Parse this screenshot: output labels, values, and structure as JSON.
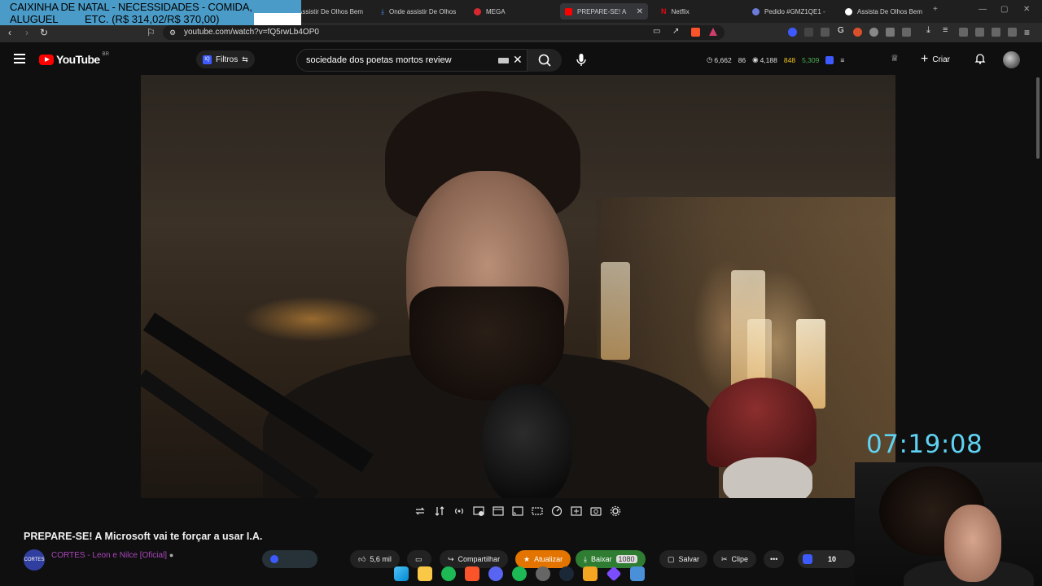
{
  "banner": {
    "line1": "CAIXINHA DE NATAL - NECESSIDADES - COMIDA, ALUGUEL",
    "line2": "ETC. (R$ 314,02/R$ 370,00)"
  },
  "tabs": [
    {
      "label": "Assistir De Olhos Bem",
      "icon": "site-icon",
      "color": "#5a5a5a"
    },
    {
      "label": "Onde assistir De Olhos",
      "icon": "download-icon",
      "color": "#4a8ff0"
    },
    {
      "label": "MEGA",
      "icon": "mega-icon",
      "color": "#d9272e"
    },
    {
      "label": "PREPARE-SE! A",
      "icon": "youtube-icon",
      "color": "#ff0000",
      "active": true
    },
    {
      "label": "Netflix",
      "icon": "netflix-icon",
      "color": "#e50914"
    },
    {
      "label": "Pedido #GMZ1QE1 -",
      "icon": "globe-icon",
      "color": "#6b7bd9"
    },
    {
      "label": "Assista De Olhos Bem",
      "icon": "circle-icon",
      "color": "#ffffff"
    }
  ],
  "address": {
    "url": "youtube.com/watch?v=fQ5rwLb4OP0"
  },
  "youtube": {
    "logo_text": "YouTube",
    "country": "BR",
    "filters_label": "Filtros",
    "search_query": "sociedade dos poetas mortos review",
    "stats": {
      "views": "6,662",
      "likes": "86",
      "watch": "4,188",
      "coins": "848",
      "points": "5,309"
    },
    "create_label": "Criar"
  },
  "video": {
    "title": "PREPARE-SE! A Microsoft vai te forçar a usar I.A.",
    "channel_avatar_text": "CORTES",
    "channel_name": "CORTES - Leon e Nilce [Oficial]",
    "like_count": "5,6 mil",
    "share_label": "Compartilhar",
    "update_label": "Atualizar",
    "download_label": "Baixar",
    "quality_label": "1080",
    "save_label": "Salvar",
    "clip_label": "Clipe",
    "side_count": "10"
  },
  "overlay": {
    "clock": "07:19:08"
  },
  "colors": {
    "accent": "#5fd3f3",
    "channel": "#ab47bc",
    "update_btn": "#e37400",
    "download_btn": "#2e7d32"
  }
}
